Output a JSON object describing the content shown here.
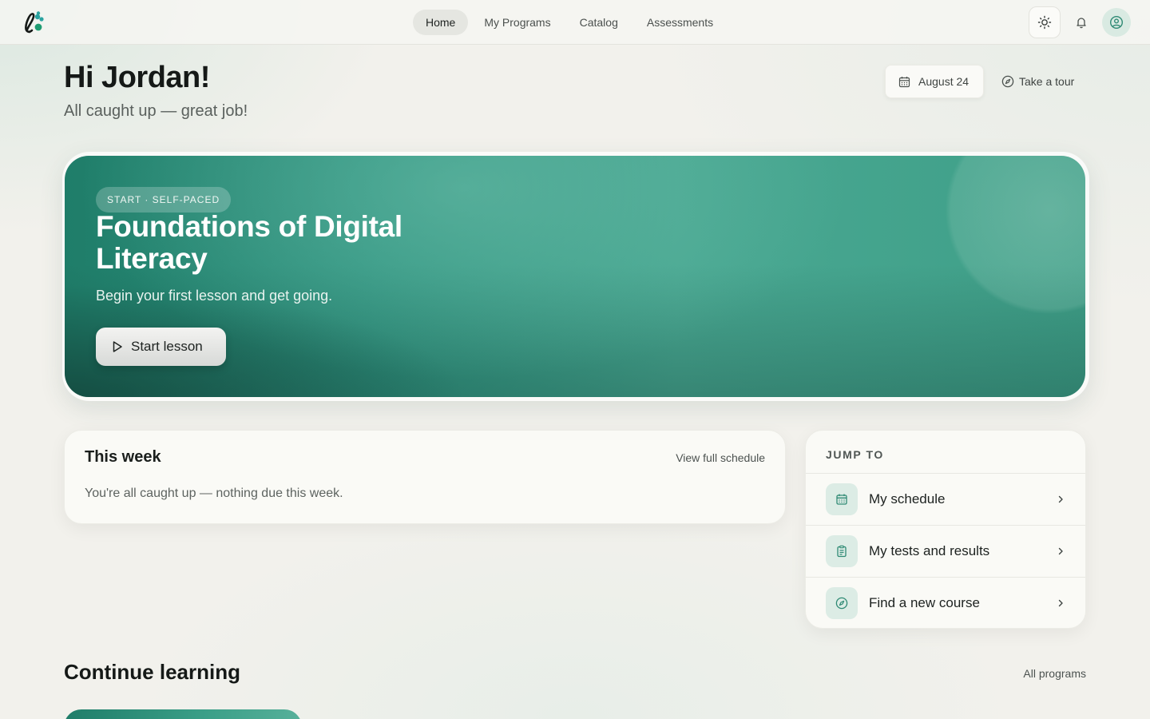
{
  "nav": {
    "items": [
      {
        "label": "Home",
        "active": true
      },
      {
        "label": "My Programs",
        "active": false
      },
      {
        "label": "Catalog",
        "active": false
      },
      {
        "label": "Assessments",
        "active": false
      }
    ]
  },
  "header_icons": [
    "sun-icon",
    "bell-icon",
    "user-circle-icon"
  ],
  "greeting": {
    "title": "Hi Jordan!",
    "subtitle": "All caught up — great job!",
    "date": "August 24",
    "tour": "Take a tour"
  },
  "hero": {
    "tag": "START · SELF-PACED",
    "title": "Foundations of Digital Literacy",
    "subtitle": "Begin your first lesson and get going.",
    "button": "Start lesson"
  },
  "week": {
    "title": "This week",
    "link": "View full schedule",
    "empty": "You're all caught up — nothing due this week."
  },
  "jump": {
    "heading": "JUMP TO",
    "items": [
      {
        "label": "My schedule",
        "icon": "calendar-icon"
      },
      {
        "label": "My tests and results",
        "icon": "clipboard-icon"
      },
      {
        "label": "Find a new course",
        "icon": "compass-icon"
      }
    ]
  },
  "continue": {
    "title": "Continue learning",
    "link": "All programs"
  },
  "colors": {
    "accent": "#2f9480",
    "accent_dark": "#1f7d69",
    "background": "#f2f1ec"
  }
}
